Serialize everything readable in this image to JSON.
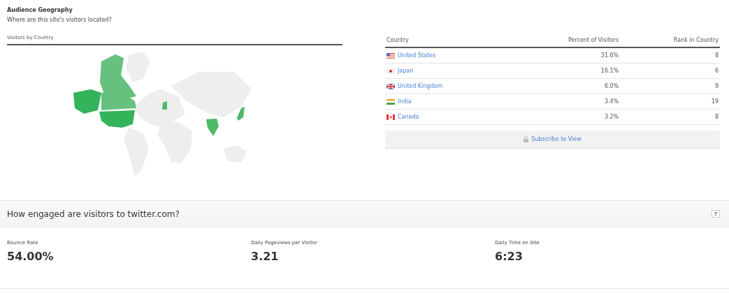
{
  "geography": {
    "title": "Audience Geography",
    "subtitle": "Where are this site's visitors located?",
    "map_title": "Visitors by Country"
  },
  "table": {
    "columns": [
      "Country",
      "Percent of Visitors",
      "Rank in Country"
    ],
    "rows": [
      {
        "kind": "us",
        "country": "United States",
        "percent": "31.6%",
        "rank": "8"
      },
      {
        "kind": "jp",
        "country": "Japan",
        "percent": "16.1%",
        "rank": "6"
      },
      {
        "kind": "gb",
        "country": "United Kingdom",
        "percent": "6.0%",
        "rank": "9"
      },
      {
        "kind": "in",
        "country": "India",
        "percent": "3.4%",
        "rank": "19"
      },
      {
        "kind": "ca",
        "country": "Canada",
        "percent": "3.2%",
        "rank": "8"
      }
    ],
    "subscribe": "Subscribe to View"
  },
  "engagement": {
    "title": "How engaged are visitors to twitter.com?",
    "help": "?",
    "metrics": [
      {
        "label": "Bounce Rate",
        "value": "54.00%"
      },
      {
        "label": "Daily Pageviews per Visitor",
        "value": "3.21"
      },
      {
        "label": "Daily Time on Site",
        "value": "6:23"
      }
    ]
  }
}
